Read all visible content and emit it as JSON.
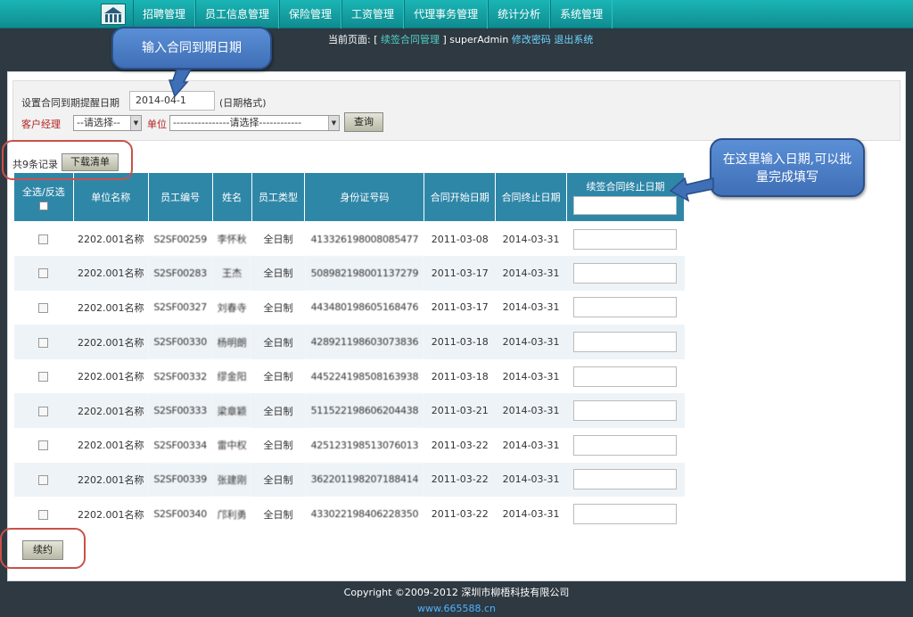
{
  "nav": {
    "items": [
      "招聘管理",
      "员工信息管理",
      "保险管理",
      "工资管理",
      "代理事务管理",
      "统计分析",
      "系统管理"
    ]
  },
  "current": {
    "prefix": "当前页面: [",
    "page": "续签合同管理",
    "suffix": "]",
    "user": "superAdmin",
    "change_password": "修改密码",
    "logout": "退出系统"
  },
  "callouts": {
    "top": "输入合同到期日期",
    "right": "在这里输入日期,可以批量完成填写"
  },
  "filter": {
    "remind_label": "设置合同到期提醒日期",
    "remind_value": "2014-04-1",
    "date_hint": "(日期格式)",
    "manager_label": "客户经理",
    "manager_value": "--请选择--",
    "unit_label": "单位",
    "unit_value": "----------------请选择------------",
    "query_button": "查询"
  },
  "records": {
    "count_text": "共9条记录",
    "download_button": "下载清单"
  },
  "table": {
    "headers": [
      "全选/反选",
      "单位名称",
      "员工编号",
      "姓名",
      "员工类型",
      "身份证号码",
      "合同开始日期",
      "合同终止日期",
      "续签合同终止日期"
    ],
    "rows": [
      {
        "unit": "2202.001名称",
        "emp_no": "S2SF00259",
        "name": "李怀秋",
        "type": "全日制",
        "id_no": "413326198008085477",
        "start": "2011-03-08",
        "end": "2014-03-31"
      },
      {
        "unit": "2202.001名称",
        "emp_no": "S2SF00283",
        "name": "王杰",
        "type": "全日制",
        "id_no": "508982198001137279",
        "start": "2011-03-17",
        "end": "2014-03-31"
      },
      {
        "unit": "2202.001名称",
        "emp_no": "S2SF00327",
        "name": "刘春寺",
        "type": "全日制",
        "id_no": "443480198605168476",
        "start": "2011-03-17",
        "end": "2014-03-31"
      },
      {
        "unit": "2202.001名称",
        "emp_no": "S2SF00330",
        "name": "杨明朗",
        "type": "全日制",
        "id_no": "428921198603073836",
        "start": "2011-03-18",
        "end": "2014-03-31"
      },
      {
        "unit": "2202.001名称",
        "emp_no": "S2SF00332",
        "name": "缪金阳",
        "type": "全日制",
        "id_no": "445224198508163938",
        "start": "2011-03-18",
        "end": "2014-03-31"
      },
      {
        "unit": "2202.001名称",
        "emp_no": "S2SF00333",
        "name": "梁章颖",
        "type": "全日制",
        "id_no": "511522198606204438",
        "start": "2011-03-21",
        "end": "2014-03-31"
      },
      {
        "unit": "2202.001名称",
        "emp_no": "S2SF00334",
        "name": "雷中权",
        "type": "全日制",
        "id_no": "425123198513076013",
        "start": "2011-03-22",
        "end": "2014-03-31"
      },
      {
        "unit": "2202.001名称",
        "emp_no": "S2SF00339",
        "name": "张建刚",
        "type": "全日制",
        "id_no": "362201198207188414",
        "start": "2011-03-22",
        "end": "2014-03-31"
      },
      {
        "unit": "2202.001名称",
        "emp_no": "S2SF00340",
        "name": "邝利勇",
        "type": "全日制",
        "id_no": "433022198406228350",
        "start": "2011-03-22",
        "end": "2014-03-31"
      }
    ]
  },
  "actions": {
    "renew_button": "续约"
  },
  "footer": {
    "copyright": "Copyright ©2009-2012 深圳市柳梧科技有限公司",
    "site": "www.665588.cn"
  }
}
